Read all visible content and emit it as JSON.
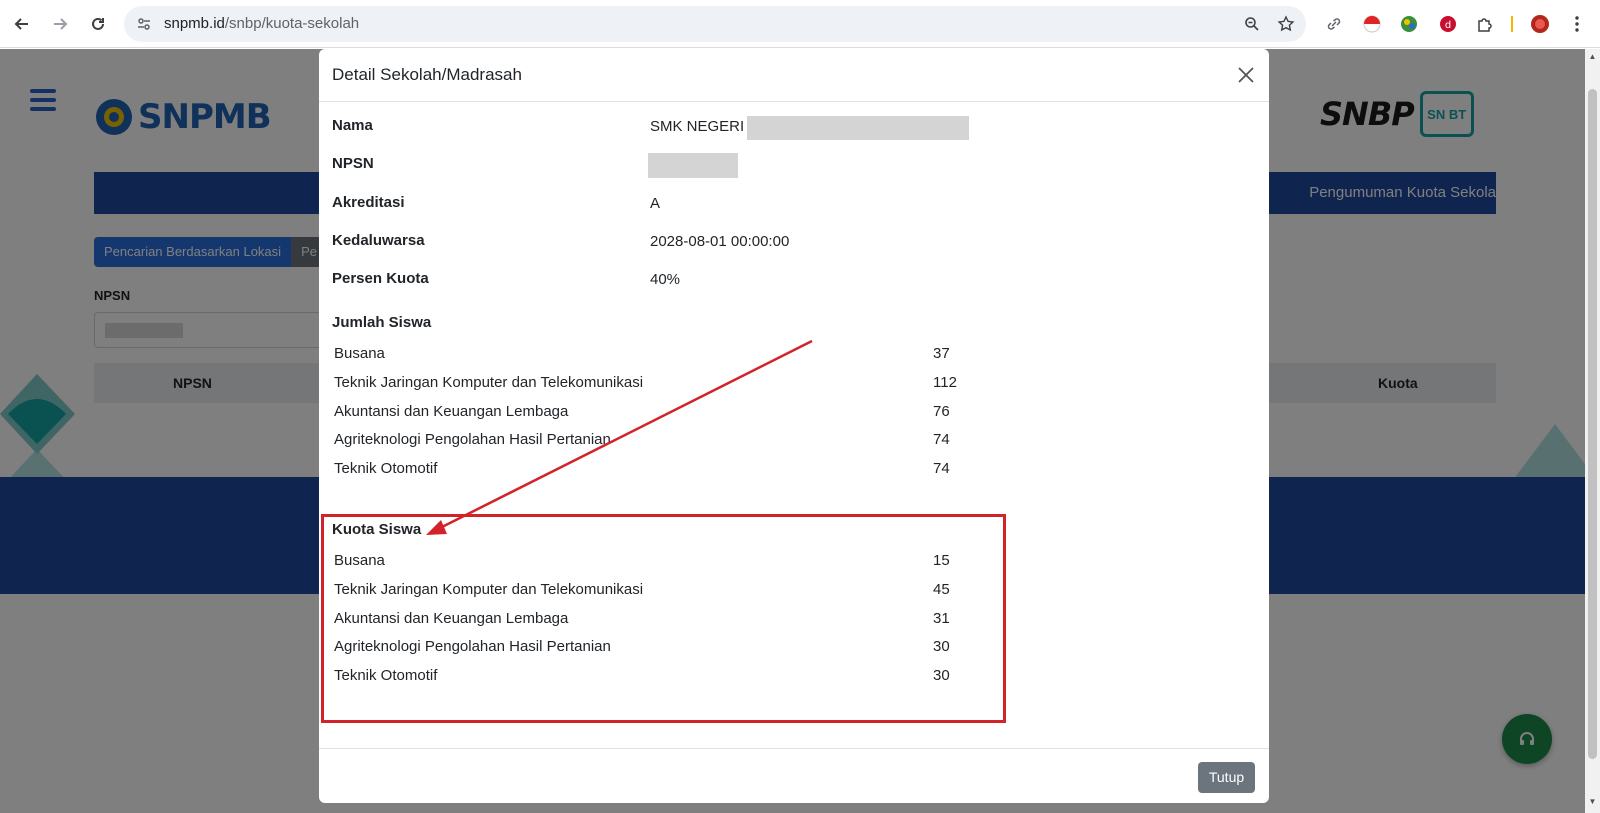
{
  "browser": {
    "url_host": "snpmb.id",
    "url_path": "/snbp/kuota-sekolah"
  },
  "page": {
    "tabs": [
      "Pencarian Berdasarkan Lokasi",
      "Pe"
    ],
    "banner_text": "Pengumuman Kuota Sekola",
    "npsn_label": "NPSN",
    "table_headers": [
      "NPSN",
      "Kuota"
    ],
    "logo_left": "SNPMB",
    "logo_right_1": "SNBP",
    "logo_right_2": "SN BT"
  },
  "modal": {
    "title": "Detail Sekolah/Madrasah",
    "fields": [
      {
        "label": "Nama",
        "value": "SMK NEGERI 1"
      },
      {
        "label": "NPSN",
        "value": ""
      },
      {
        "label": "Akreditasi",
        "value": "A"
      },
      {
        "label": "Kedaluwarsa",
        "value": "2028-08-01 00:00:00"
      },
      {
        "label": "Persen Kuota",
        "value": "40%"
      }
    ],
    "jumlah_siswa": {
      "title": "Jumlah Siswa",
      "rows": [
        {
          "name": "Busana",
          "value": "37"
        },
        {
          "name": "Teknik Jaringan Komputer dan Telekomunikasi",
          "value": "112"
        },
        {
          "name": "Akuntansi dan Keuangan Lembaga",
          "value": "76"
        },
        {
          "name": "Agriteknologi Pengolahan Hasil Pertanian",
          "value": "74"
        },
        {
          "name": "Teknik Otomotif",
          "value": "74"
        }
      ]
    },
    "kuota_siswa": {
      "title": "Kuota Siswa",
      "rows": [
        {
          "name": "Busana",
          "value": "15"
        },
        {
          "name": "Teknik Jaringan Komputer dan Telekomunikasi",
          "value": "45"
        },
        {
          "name": "Akuntansi dan Keuangan Lembaga",
          "value": "31"
        },
        {
          "name": "Agriteknologi Pengolahan Hasil Pertanian",
          "value": "30"
        },
        {
          "name": "Teknik Otomotif",
          "value": "30"
        }
      ]
    },
    "close_button": "Tutup"
  },
  "colors": {
    "primary_blue": "#1f4aa0",
    "annotation_red": "#d2232a",
    "button_gray": "#6c757d"
  }
}
